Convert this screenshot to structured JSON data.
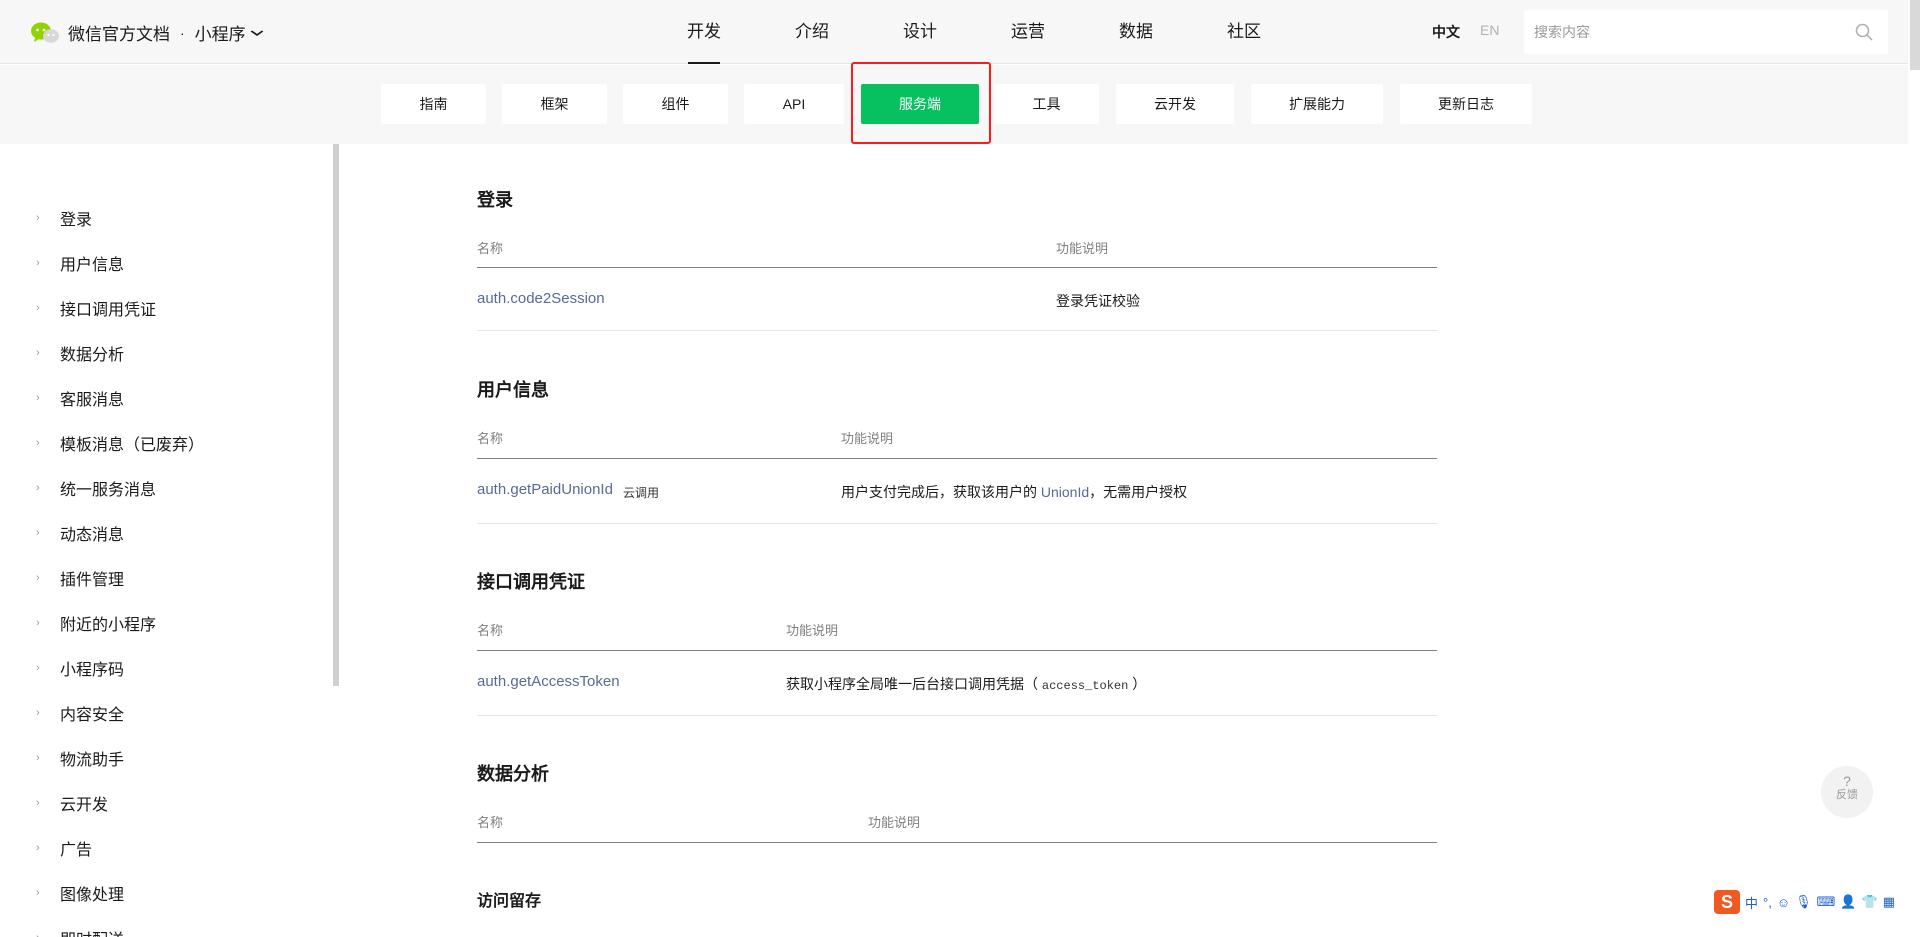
{
  "header": {
    "brand": "微信官方文档",
    "separator": "·",
    "product": "小程序",
    "nav": [
      {
        "label": "开发",
        "active": true
      },
      {
        "label": "介绍",
        "active": false
      },
      {
        "label": "设计",
        "active": false
      },
      {
        "label": "运营",
        "active": false
      },
      {
        "label": "数据",
        "active": false
      },
      {
        "label": "社区",
        "active": false
      }
    ],
    "lang_zh": "中文",
    "lang_en": "EN",
    "search_placeholder": "搜索内容"
  },
  "subnav": [
    {
      "label": "指南",
      "active": false
    },
    {
      "label": "框架",
      "active": false
    },
    {
      "label": "组件",
      "active": false
    },
    {
      "label": "API",
      "active": false
    },
    {
      "label": "服务端",
      "active": true
    },
    {
      "label": "工具",
      "active": false
    },
    {
      "label": "云开发",
      "active": false
    },
    {
      "label": "扩展能力",
      "active": false
    },
    {
      "label": "更新日志",
      "active": false
    }
  ],
  "sidebar": {
    "items": [
      {
        "label": "登录"
      },
      {
        "label": "用户信息"
      },
      {
        "label": "接口调用凭证"
      },
      {
        "label": "数据分析"
      },
      {
        "label": "客服消息"
      },
      {
        "label": "模板消息（已废弃）"
      },
      {
        "label": "统一服务消息"
      },
      {
        "label": "动态消息"
      },
      {
        "label": "插件管理"
      },
      {
        "label": "附近的小程序"
      },
      {
        "label": "小程序码"
      },
      {
        "label": "内容安全"
      },
      {
        "label": "物流助手"
      },
      {
        "label": "云开发"
      },
      {
        "label": "广告"
      },
      {
        "label": "图像处理"
      },
      {
        "label": "即时配送"
      }
    ]
  },
  "sections": [
    {
      "title": "登录",
      "col_name": "名称",
      "col_desc": "功能说明",
      "rows": [
        {
          "name": "auth.code2Session",
          "tag": "",
          "desc": "登录凭证校验"
        }
      ]
    },
    {
      "title": "用户信息",
      "col_name": "名称",
      "col_desc": "功能说明",
      "rows": [
        {
          "name": "auth.getPaidUnionId",
          "tag": "云调用",
          "desc_pre": "用户支付完成后，获取该用户的 ",
          "desc_link": "UnionId",
          "desc_post": "，无需用户授权"
        }
      ]
    },
    {
      "title": "接口调用凭证",
      "col_name": "名称",
      "col_desc": "功能说明",
      "rows": [
        {
          "name": "auth.getAccessToken",
          "tag": "",
          "desc_pre": "获取小程序全局唯一后台接口调用凭据（ ",
          "desc_code": "access_token",
          "desc_post": " ）"
        }
      ]
    },
    {
      "title": "数据分析",
      "col_name": "名称",
      "col_desc": "功能说明",
      "subsection": "访问留存"
    }
  ],
  "feedback": {
    "symbol": "?",
    "label": "反馈"
  },
  "ime": {
    "logo": "S",
    "mode": "中",
    "punct": "°,"
  }
}
